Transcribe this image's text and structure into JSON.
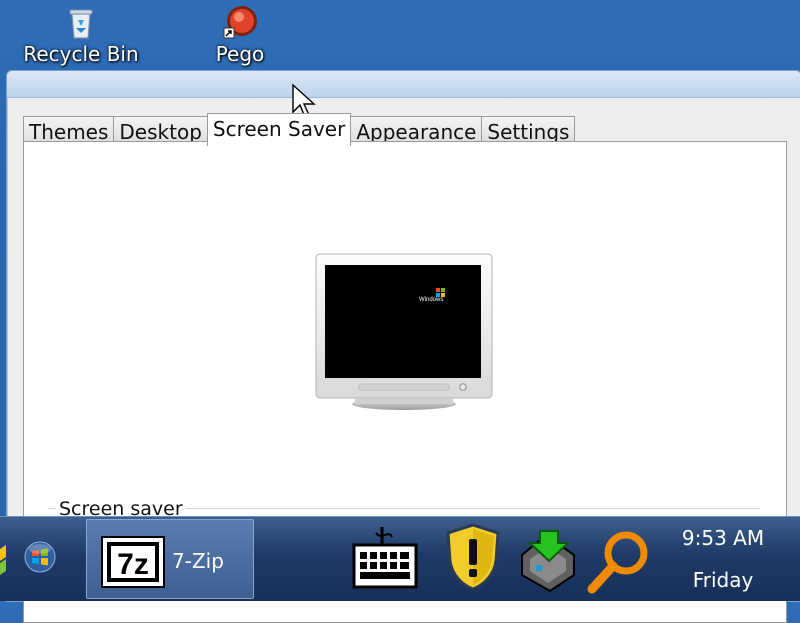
{
  "desktop": {
    "icons": [
      {
        "label": "Recycle Bin",
        "icon": "recycle-bin-icon"
      },
      {
        "label": "Pego",
        "icon": "pego-shortcut-icon"
      }
    ]
  },
  "dialog": {
    "tabs": [
      "Themes",
      "Desktop",
      "Screen Saver",
      "Appearance",
      "Settings"
    ],
    "active_tab": "Screen Saver",
    "preview": {
      "icon": "monitor-preview-icon",
      "screen_logo": "Windows"
    },
    "section_label": "Screen saver"
  },
  "taskbar": {
    "start_icon": "windows-orb-icon",
    "tasks": [
      {
        "label": "7-Zip",
        "icon": "7zip-icon",
        "icon_text": "7z"
      }
    ],
    "tray_icons": [
      "keyboard-icon",
      "security-shield-icon",
      "network-icon",
      "search-icon"
    ],
    "clock": {
      "time": "9:53 AM",
      "day": "Friday"
    }
  },
  "colors": {
    "desktop": "#2a67b0",
    "taskbar": "#1f3a66",
    "accent_orange": "#f08a00"
  }
}
